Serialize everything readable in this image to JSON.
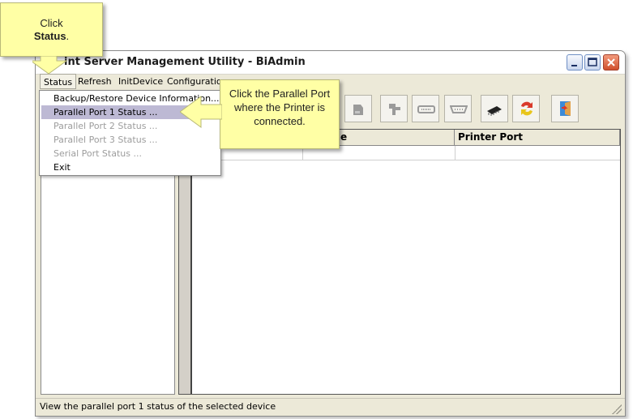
{
  "window": {
    "title": "int Server Management Utility - BiAdmin",
    "controls": [
      "minimize-icon",
      "maximize-icon",
      "close-icon"
    ]
  },
  "menu": [
    "Status",
    "Refresh",
    "InitDevice",
    "Configuration"
  ],
  "status_menu": {
    "items": [
      {
        "label": "Backup/Restore Device Information...",
        "enabled": true
      },
      {
        "label": "Parallel  Port 1 Status ...",
        "enabled": true,
        "highlighted": true
      },
      {
        "label": "Parallel  Port 2 Status ...",
        "enabled": false
      },
      {
        "label": "Parallel  Port 3 Status ...",
        "enabled": false
      },
      {
        "label": "Serial Port Status ...",
        "enabled": false
      },
      {
        "label": "Exit",
        "enabled": true
      }
    ]
  },
  "toolbar": {
    "icons": [
      "network-printer-icon",
      "hub-icon",
      "parallel-port-icon",
      "serial-port-icon",
      "chip-icon",
      "exchange-icon",
      "exit-door-icon"
    ]
  },
  "table": {
    "columns": [
      "e Name",
      "Printer Port"
    ]
  },
  "status_text": "View the parallel  port 1 status of the selected device",
  "callouts": {
    "click_status": {
      "line1": "Click",
      "line2": "Status",
      "line2_suffix": "."
    },
    "click_parallel": "Click the Parallel Port where the Printer is connected."
  },
  "colors": {
    "callout_bg": "#ffffa5",
    "menu_highlight": "#bdb9d4",
    "window_bg": "#ece9d8"
  }
}
